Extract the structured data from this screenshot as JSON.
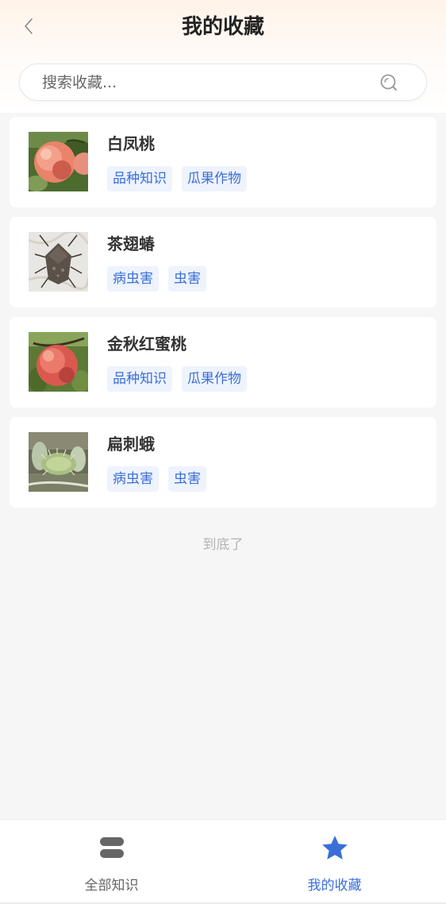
{
  "header": {
    "title": "我的收藏",
    "back_icon": "chevron-left-icon"
  },
  "search": {
    "placeholder": "搜索收藏...",
    "value": "",
    "icon": "search-icon"
  },
  "items": [
    {
      "title": "白凤桃",
      "tags": [
        "品种知识",
        "瓜果作物"
      ],
      "image": "peach-image"
    },
    {
      "title": "茶翅蝽",
      "tags": [
        "病虫害",
        "虫害"
      ],
      "image": "stink-bug-image"
    },
    {
      "title": "金秋红蜜桃",
      "tags": [
        "品种知识",
        "瓜果作物"
      ],
      "image": "red-peach-image"
    },
    {
      "title": "扁刺蛾",
      "tags": [
        "病虫害",
        "虫害"
      ],
      "image": "caterpillar-image"
    }
  ],
  "end_text": "到底了",
  "tabbar": {
    "tabs": [
      {
        "label": "全部知识",
        "icon": "stack-icon",
        "active": false
      },
      {
        "label": "我的收藏",
        "icon": "star-icon",
        "active": true
      }
    ],
    "active_color": "#3a6fd8",
    "inactive_color": "#666666"
  },
  "colors": {
    "tag_bg": "#eef3fd",
    "tag_text": "#3a6fd8",
    "header_gradient_top": "#fff3e8"
  }
}
